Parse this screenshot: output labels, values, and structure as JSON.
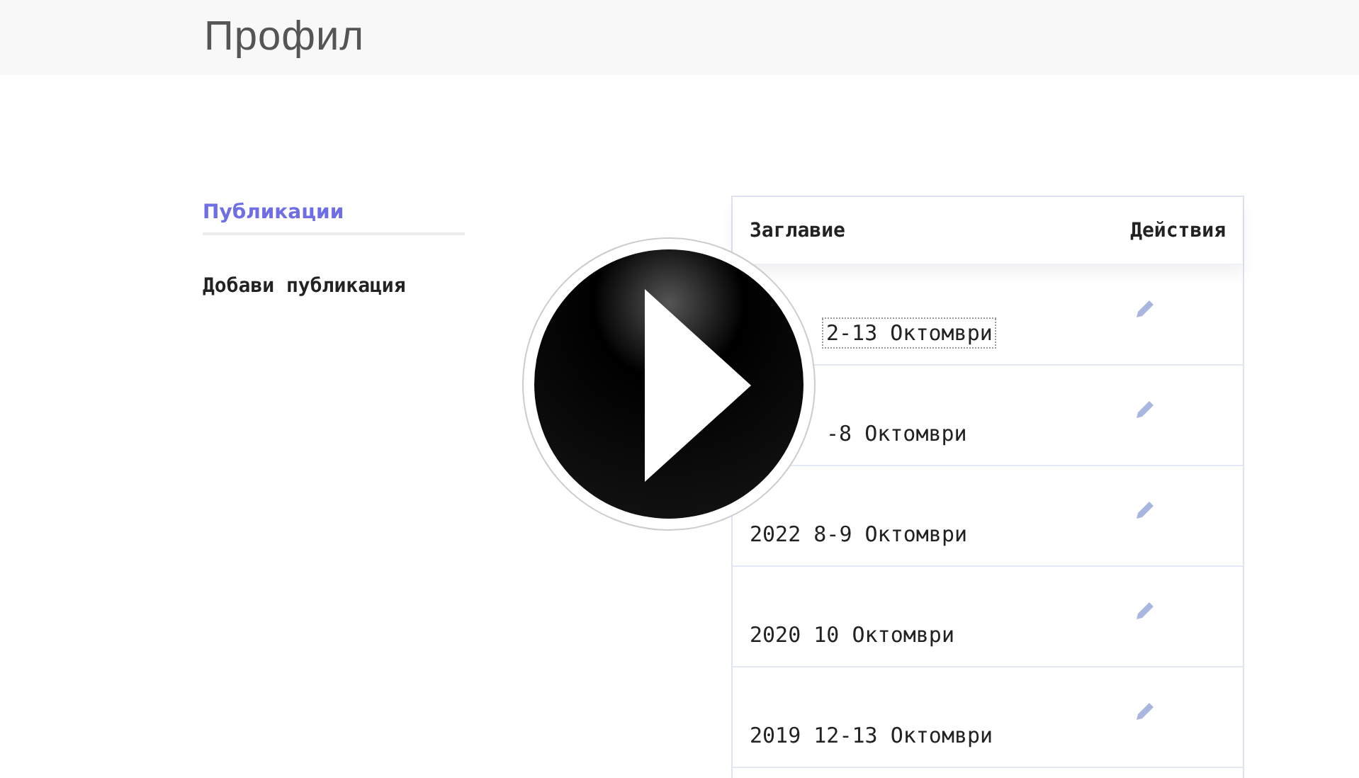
{
  "header": {
    "title": "Профил"
  },
  "sidebar": {
    "items": [
      {
        "label": "Публикации",
        "selected": true
      },
      {
        "label": "Добави публикация",
        "selected": false
      }
    ]
  },
  "table": {
    "columns": [
      "Заглавие",
      "Действия"
    ],
    "rows": [
      {
        "title": "2-13 Октомври",
        "focused": true
      },
      {
        "title": "-8 Октомври",
        "focused": false
      },
      {
        "title": "2022 8-9 Октомври",
        "focused": false
      },
      {
        "title": "2020 10 Октомври",
        "focused": false
      },
      {
        "title": "2019 12-13 Октомври",
        "focused": false
      }
    ]
  }
}
